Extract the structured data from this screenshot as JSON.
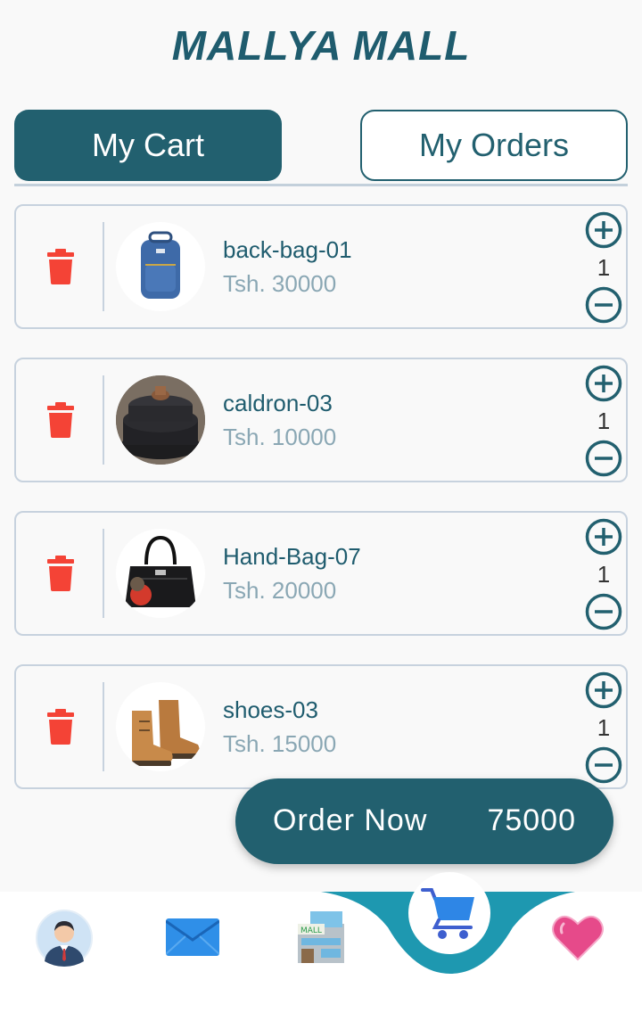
{
  "header": {
    "logo_text": "MALLYA MALL"
  },
  "tabs": [
    {
      "label": "My Cart",
      "active": true
    },
    {
      "label": "My Orders",
      "active": false
    }
  ],
  "cart": {
    "items": [
      {
        "name": "back-bag-01",
        "price": "Tsh. 30000",
        "quantity": "1",
        "image": "blue-backpack-image"
      },
      {
        "name": "caldron-03",
        "price": "Tsh. 10000",
        "quantity": "1",
        "image": "black-pot-image"
      },
      {
        "name": "Hand-Bag-07",
        "price": "Tsh. 20000",
        "quantity": "1",
        "image": "black-handbag-image"
      },
      {
        "name": "shoes-03",
        "price": "Tsh. 15000",
        "quantity": "1",
        "image": "brown-boots-image"
      }
    ]
  },
  "order": {
    "label": "Order Now",
    "total": "75000"
  },
  "bottom_nav": {
    "items": [
      "profile-avatar-icon",
      "mail-icon",
      "mall-building-icon",
      "cart-icon",
      "heart-icon"
    ],
    "active": "cart-icon"
  },
  "colors": {
    "primary": "#22606f",
    "delete": "#f44336",
    "price": "#8aa7b4",
    "nav_curve": "#1e98b0"
  }
}
